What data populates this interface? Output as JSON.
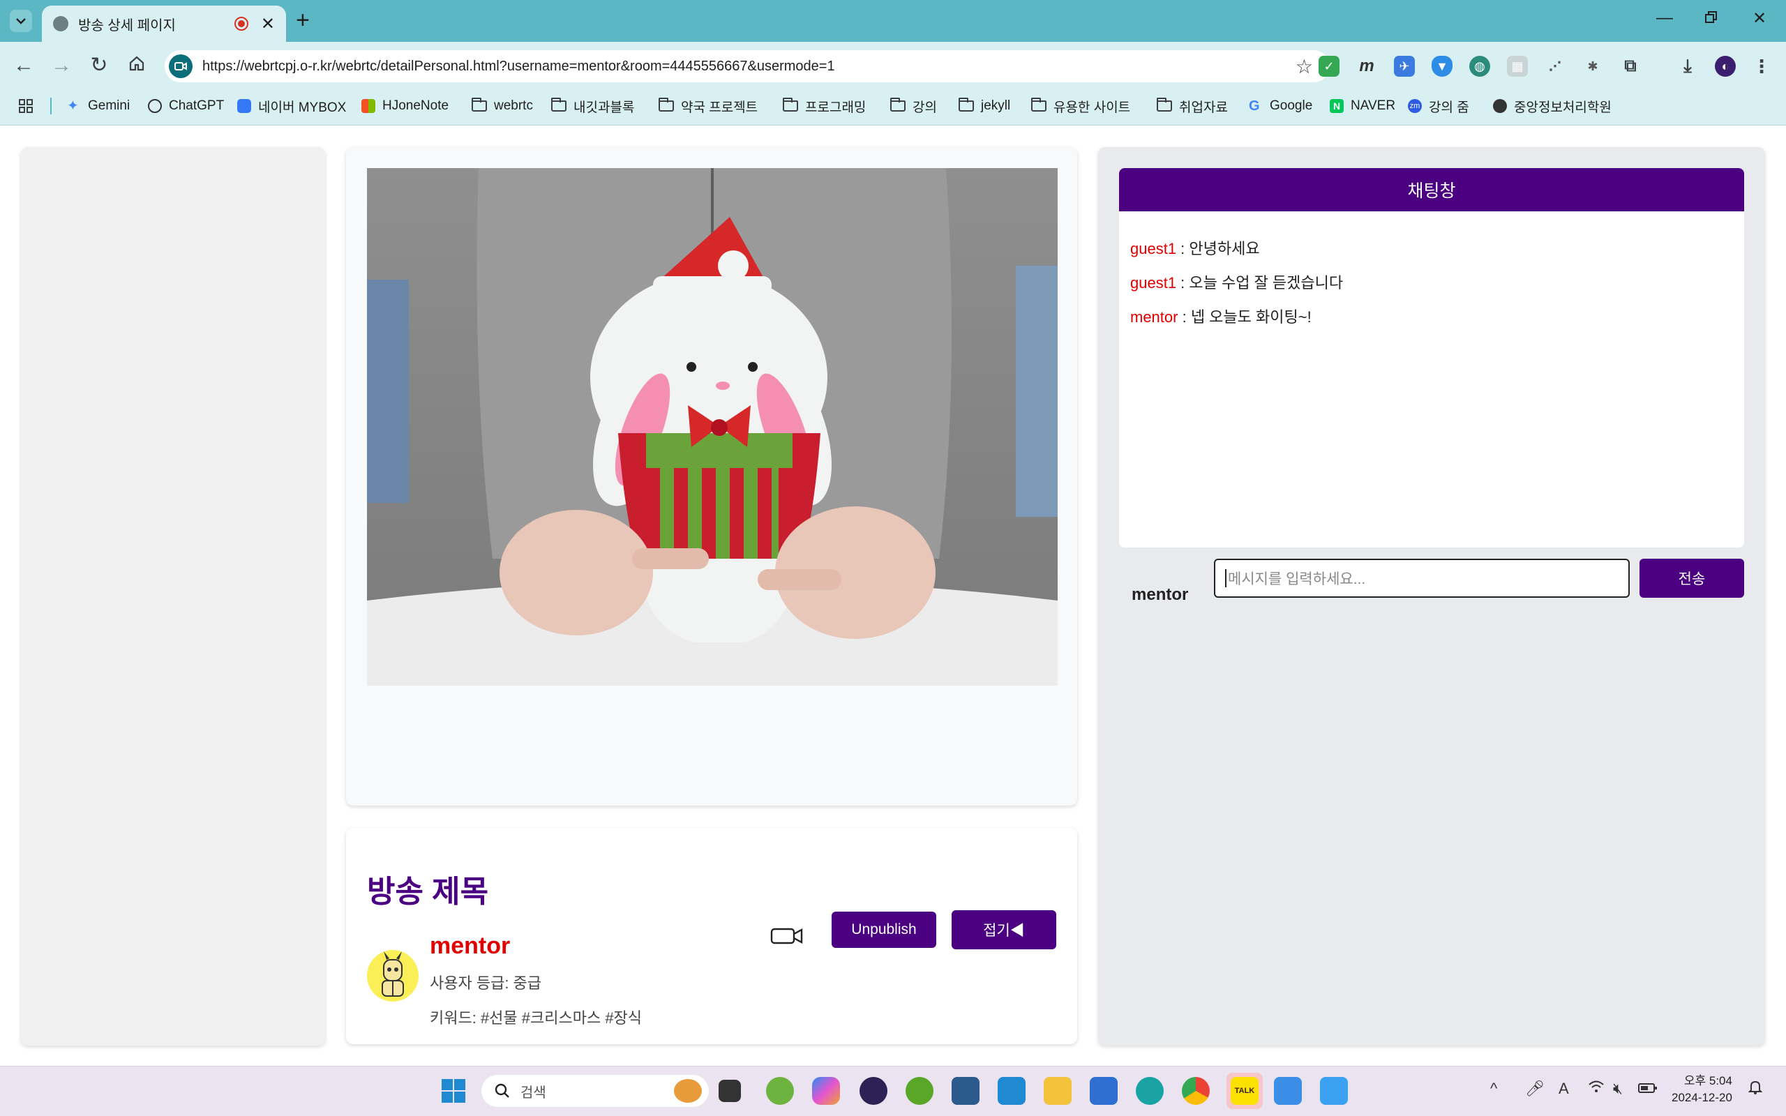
{
  "browser": {
    "tab_title": "방송 상세 페이지",
    "new_tab_icon": "+",
    "url": "https://webrtcpj.o-r.kr/webrtc/detailPersonal.html?username=mentor&room=4445556667&usermode=1",
    "bookmarks": [
      {
        "label": "Gemini",
        "type": "site"
      },
      {
        "label": "ChatGPT",
        "type": "site"
      },
      {
        "label": "네이버 MYBOX",
        "type": "site"
      },
      {
        "label": "HJoneNote",
        "type": "site"
      },
      {
        "label": "webrtc",
        "type": "folder"
      },
      {
        "label": "내깃과블록",
        "type": "folder"
      },
      {
        "label": "약국 프로젝트",
        "type": "folder"
      },
      {
        "label": "프로그래밍",
        "type": "folder"
      },
      {
        "label": "강의",
        "type": "folder"
      },
      {
        "label": "jekyll",
        "type": "folder"
      },
      {
        "label": "유용한 사이트",
        "type": "folder"
      },
      {
        "label": "취업자료",
        "type": "folder"
      },
      {
        "label": "Google",
        "type": "site"
      },
      {
        "label": "NAVER",
        "type": "site"
      },
      {
        "label": "강의 줌",
        "type": "site"
      },
      {
        "label": "중앙정보처리학원",
        "type": "site"
      }
    ]
  },
  "stream": {
    "title": "방송 제목",
    "author": "mentor",
    "grade": "사용자 등급: 중급",
    "keywords": "키워드: #선물 #크리스마스 #장식",
    "unpublish_label": "Unpublish",
    "collapse_label": "접기◀"
  },
  "chat": {
    "header": "채팅창",
    "messages": [
      {
        "user": "guest1",
        "text": " : 안녕하세요"
      },
      {
        "user": "guest1",
        "text": " : 오늘 수업 잘 듣겠습니다"
      },
      {
        "user": "mentor",
        "text": " : 넵 오늘도 화이팅~!"
      }
    ],
    "current_user": "mentor",
    "input_placeholder": "메시지를 입력하세요...",
    "send_label": "전송"
  },
  "taskbar": {
    "search_placeholder": "검색",
    "clock_time": "오후 5:04",
    "clock_date": "2024-12-20"
  },
  "colors": {
    "accent": "#4b0082",
    "username": "#e00000",
    "chrome": "#5bb7c4"
  }
}
